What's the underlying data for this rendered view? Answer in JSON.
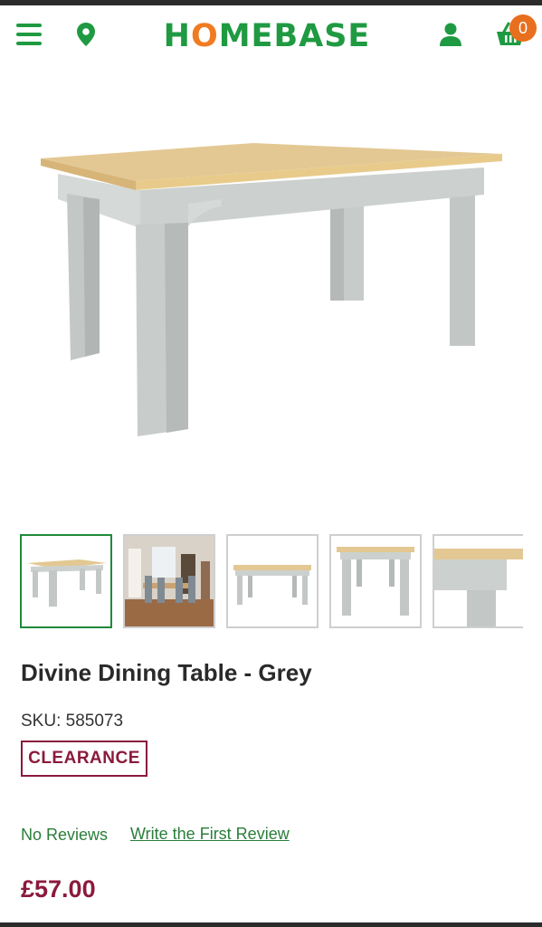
{
  "header": {
    "logo_prefix": "H",
    "logo_o": "O",
    "logo_suffix": "MEBASE",
    "basket_count": "0",
    "menu_icon": "hamburger-menu-icon",
    "location_icon": "location-pin-icon",
    "account_icon": "user-icon",
    "basket_icon": "basket-icon",
    "brand_green": "#1f9a42",
    "brand_orange": "#f07b22"
  },
  "gallery": {
    "selected_index": 0,
    "thumbnail_count": 5
  },
  "product": {
    "title": "Divine Dining Table - Grey",
    "sku": "SKU: 585073",
    "badge": "CLEARANCE",
    "reviews_text": "No Reviews",
    "write_review": "Write the First Review",
    "price": "£57.00",
    "price_color": "#8b1a3c"
  }
}
